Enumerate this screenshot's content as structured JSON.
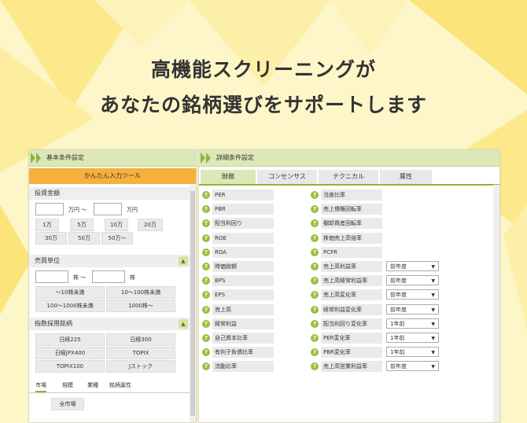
{
  "headline": {
    "line1": "高機能スクリーニングが",
    "line2": "あなたの銘柄選びをサポートします"
  },
  "left_panel": {
    "title": "基本条件設定",
    "easy_tool": "かんたん入力ツール",
    "investment": {
      "title": "投資金額",
      "unit1": "万円 ～",
      "unit2": "万円",
      "buttons": [
        "1万",
        "5万",
        "10万",
        "20万",
        "30万",
        "50万",
        "50万～"
      ]
    },
    "trading_unit": {
      "title": "売買単位",
      "unit1": "株 ～",
      "unit2": "株",
      "buttons": [
        "～10株未満",
        "10～100株未満",
        "100～1000株未満",
        "1000株～"
      ]
    },
    "index": {
      "title": "指数採用銘柄",
      "buttons": [
        "日経225",
        "日経300",
        "日経JPX400",
        "TOPIX",
        "TOPIX100",
        "Jストック"
      ]
    },
    "tabs": [
      "市場",
      "規模",
      "業種",
      "銘柄属性"
    ],
    "market_button": "全市場",
    "collapse_icon": "chevron-up-icon"
  },
  "right_panel": {
    "title": "詳細条件設定",
    "tabs": [
      "財務",
      "コンセンサス",
      "テクニカル",
      "属性"
    ],
    "left_items": [
      "PER",
      "PBR",
      "配当利回り",
      "ROE",
      "ROA",
      "時価総額",
      "BPS",
      "EPS",
      "売上高",
      "経常利益",
      "自己資本比率",
      "有利子負債比率",
      "流動比率"
    ],
    "right_items": [
      {
        "label": "当座比率",
        "select": ""
      },
      {
        "label": "売上債権回転率",
        "select": ""
      },
      {
        "label": "棚卸資産回転率",
        "select": ""
      },
      {
        "label": "株価売上高倍率",
        "select": ""
      },
      {
        "label": "PCFR",
        "select": ""
      },
      {
        "label": "売上高利益率",
        "select": "前年度"
      },
      {
        "label": "売上高経常利益率",
        "select": "前年度"
      },
      {
        "label": "売上高変化率",
        "select": "前年度"
      },
      {
        "label": "経常利益変化率",
        "select": "前年度"
      },
      {
        "label": "配当利回り変化率",
        "select": "1年前"
      },
      {
        "label": "PER変化率",
        "select": "1年前"
      },
      {
        "label": "PBR変化率",
        "select": "1年前"
      },
      {
        "label": "売上高営業利益率",
        "select": "前年度"
      }
    ],
    "help_icon": "question-icon"
  },
  "colors": {
    "accent_green": "#8fb43a",
    "header_green": "#dce8b7",
    "orange": "#f6b03b",
    "background": "#fdf6c8"
  }
}
